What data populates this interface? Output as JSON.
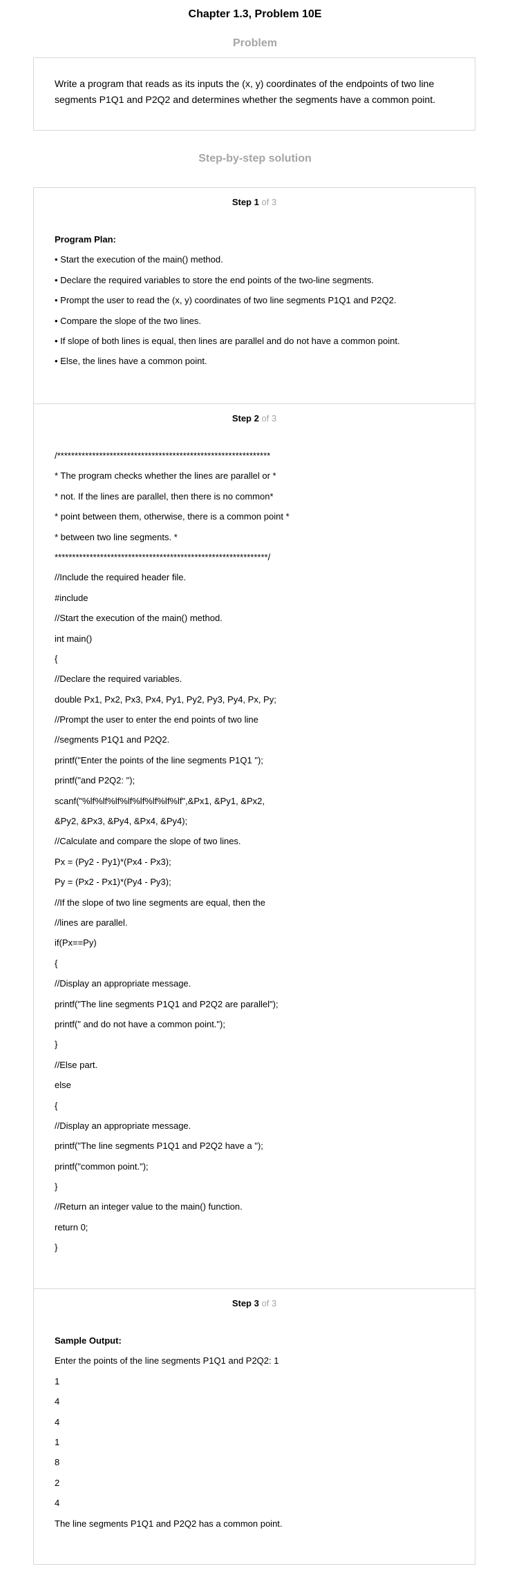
{
  "page_title": "Chapter 1.3, Problem 10E",
  "problem_heading": "Problem",
  "problem_text": "Write a program that reads as its inputs the (x, y) coordinates of the endpoints of two line segments P1Q1 and P2Q2 and determines whether the segments have a common point.",
  "solution_heading": "Step-by-step solution",
  "of_label": "of 3",
  "steps": [
    {
      "label": "Step 1",
      "lines": [
        "Program Plan:",
        "• Start the execution of the main() method.",
        "• Declare the required variables to store the end points of the two-line segments.",
        "• Prompt the user to read the (x, y) coordinates of two line segments P1Q1 and P2Q2.",
        "• Compare the slope of the two lines.",
        "• If slope of both lines is equal, then lines are parallel and do not have a common point.",
        "• Else, the lines have a common point."
      ]
    },
    {
      "label": "Step 2",
      "lines": [
        "/*************************************************************",
        "* The program checks whether the lines are parallel or *",
        "* not. If the lines are parallel, then there is no common*",
        "* point between them, otherwise, there is a common point *",
        "* between two line segments. *",
        "*************************************************************/",
        "//Include the required header file.",
        "#include",
        "//Start the execution of the main() method.",
        "int main()",
        "{",
        "//Declare the required variables.",
        "double Px1, Px2, Px3, Px4, Py1, Py2, Py3, Py4, Px, Py;",
        "//Prompt the user to enter the end points of two line",
        "//segments P1Q1 and P2Q2.",
        "printf(\"Enter the points of the line segments P1Q1 \");",
        "printf(\"and P2Q2: \");",
        "scanf(\"%lf%lf%lf%lf%lf%lf%lf%lf\",&Px1, &Py1, &Px2,",
        "&Py2, &Px3, &Py4, &Px4, &Py4);",
        "//Calculate and compare the slope of two lines.",
        "Px = (Py2 - Py1)*(Px4 - Px3);",
        "Py = (Px2 - Px1)*(Py4 - Py3);",
        "//If the slope of two line segments are equal, then the",
        "//lines are parallel.",
        "if(Px==Py)",
        "{",
        "//Display an appropriate message.",
        "printf(\"The line segments P1Q1 and P2Q2 are parallel\");",
        "printf(\" and do not have a common point.\");",
        "}",
        "//Else part.",
        "else",
        "{",
        "//Display an appropriate message.",
        "printf(\"The line segments P1Q1 and P2Q2 have a \");",
        "printf(\"common point.\");",
        "}",
        "//Return an integer value to the main() function.",
        "return 0;",
        "}"
      ]
    },
    {
      "label": "Step 3",
      "lines": [
        "Sample Output:",
        "Enter the points of the line segments P1Q1 and P2Q2: 1",
        "1",
        "4",
        "4",
        "1",
        "8",
        "2",
        "4",
        "The line segments P1Q1 and P2Q2 has a common point."
      ]
    }
  ]
}
